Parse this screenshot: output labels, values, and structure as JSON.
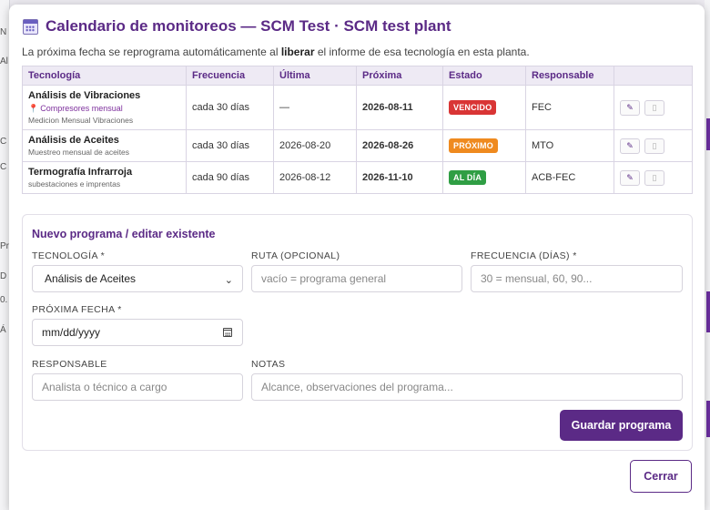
{
  "modal": {
    "title": "Calendario de monitoreos — SCM Test · SCM test plant",
    "subtitle_pre": "La próxima fecha se reprograma automáticamente al ",
    "subtitle_bold": "liberar",
    "subtitle_post": " el informe de esa tecnología en esta planta.",
    "close_label": "Cerrar"
  },
  "table": {
    "headers": [
      "Tecnología",
      "Frecuencia",
      "Última",
      "Próxima",
      "Estado",
      "Responsable",
      ""
    ],
    "rows": [
      {
        "tech": "Análisis de Vibraciones",
        "route": "Compresores mensual",
        "desc": "Medicion Mensual Vibraciones",
        "freq": "cada 30 días",
        "last": "—",
        "next": "2026-08-11",
        "status": "VENCIDO",
        "status_color": "#d93535",
        "owner": "FEC"
      },
      {
        "tech": "Análisis de Aceites",
        "route": "",
        "desc": "Muestreo mensual de aceites",
        "freq": "cada 30 días",
        "last": "2026-08-20",
        "next": "2026-08-26",
        "status": "PRÓXIMO",
        "status_color": "#ef8a1f",
        "owner": "MTO"
      },
      {
        "tech": "Termografía Infrarroja",
        "route": "",
        "desc": "subestaciones e imprentas",
        "freq": "cada 90 días",
        "last": "2026-08-12",
        "next": "2026-11-10",
        "status": "AL DÍA",
        "status_color": "#2f9e44",
        "owner": "ACB-FEC"
      }
    ]
  },
  "form": {
    "title": "Nuevo programa / editar existente",
    "tech_label": "TECNOLOGÍA *",
    "tech_value": "Análisis de Aceites",
    "route_label": "RUTA (OPCIONAL)",
    "route_placeholder": "vacío = programa general",
    "freq_label": "FRECUENCIA (DÍAS) *",
    "freq_placeholder": "30 = mensual, 60, 90...",
    "date_label": "PRÓXIMA FECHA *",
    "date_placeholder": "mm/dd/yyyy",
    "owner_label": "RESPONSABLE",
    "owner_placeholder": "Analista o técnico a cargo",
    "notes_label": "NOTAS",
    "notes_placeholder": "Alcance, observaciones del programa...",
    "save_label": "Guardar programa"
  },
  "background": {
    "left_chars": [
      "N",
      "Al",
      "C",
      "C",
      "Pr",
      "D",
      "0.",
      "Á"
    ]
  }
}
